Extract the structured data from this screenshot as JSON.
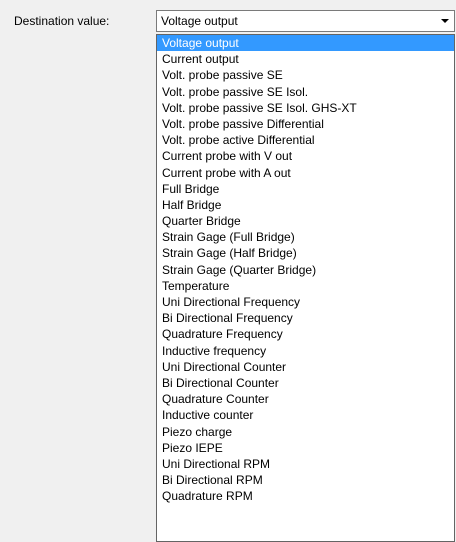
{
  "form": {
    "label": "Destination value:",
    "selected_value": "Voltage output"
  },
  "colors": {
    "selection_highlight": "#3399ff",
    "panel_background": "#f0f0f0"
  },
  "dropdown": {
    "items": [
      "Voltage output",
      "Current output",
      "Volt. probe passive SE",
      "Volt. probe passive SE Isol.",
      "Volt. probe passive SE Isol. GHS-XT",
      "Volt. probe passive Differential",
      "Volt. probe active Differential",
      "Current probe with V out",
      "Current probe with A out",
      "Full Bridge",
      "Half Bridge",
      "Quarter Bridge",
      "Strain Gage (Full Bridge)",
      "Strain Gage (Half Bridge)",
      "Strain Gage (Quarter Bridge)",
      "Temperature",
      "Uni Directional Frequency",
      "Bi Directional Frequency",
      "Quadrature Frequency",
      "Inductive frequency",
      "Uni Directional Counter",
      "Bi Directional Counter",
      "Quadrature Counter",
      "Inductive counter",
      "Piezo charge",
      "Piezo IEPE",
      "Uni Directional RPM",
      "Bi Directional RPM",
      "Quadrature RPM"
    ],
    "selected_index": 0
  }
}
